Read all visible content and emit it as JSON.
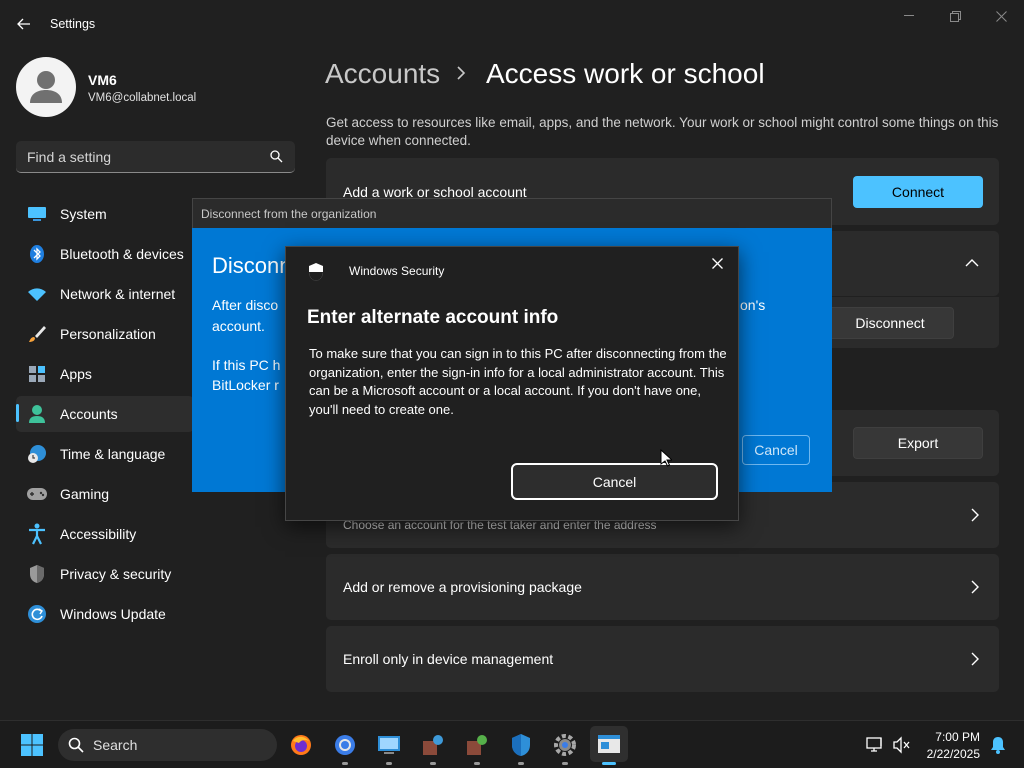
{
  "window": {
    "app_title": "Settings"
  },
  "user": {
    "name": "VM6",
    "email": "VM6@collabnet.local"
  },
  "search": {
    "placeholder": "Find a setting"
  },
  "nav": [
    {
      "label": "System",
      "icon": "monitor-icon"
    },
    {
      "label": "Bluetooth & devices",
      "icon": "bluetooth-icon"
    },
    {
      "label": "Network & internet",
      "icon": "wifi-icon"
    },
    {
      "label": "Personalization",
      "icon": "brush-icon"
    },
    {
      "label": "Apps",
      "icon": "apps-icon"
    },
    {
      "label": "Accounts",
      "icon": "person-icon",
      "active": true
    },
    {
      "label": "Time & language",
      "icon": "globe-clock-icon"
    },
    {
      "label": "Gaming",
      "icon": "gamepad-icon"
    },
    {
      "label": "Accessibility",
      "icon": "accessibility-icon"
    },
    {
      "label": "Privacy & security",
      "icon": "shield-icon"
    },
    {
      "label": "Windows Update",
      "icon": "update-icon"
    }
  ],
  "header": {
    "parent": "Accounts",
    "current": "Access work or school"
  },
  "intro": "Get access to resources like email, apps, and the network. Your work or school might control some things on this device when connected.",
  "cards": {
    "add_account": {
      "label": "Add a work or school account",
      "button": "Connect"
    },
    "disconnect_button": "Disconnect",
    "export_button": "Export",
    "test_sub": "Choose an account for the test taker and enter the address",
    "provisioning": "Add or remove a provisioning package",
    "enroll": "Enroll only in device management"
  },
  "disconnect_dialog": {
    "title": "Disconnect from the organization",
    "heading": "Disconn",
    "line1": "After disco",
    "line1_tail": "on's",
    "line2": "account.",
    "line3": "If this PC h",
    "line4": "BitLocker r",
    "cancel": "Cancel"
  },
  "security_dialog": {
    "title": "Windows Security",
    "heading": "Enter alternate account info",
    "body": "To make sure that you can sign in to this PC after disconnecting from the organization, enter the sign-in info for a local administrator account. This can be a Microsoft account or a local account. If you don't have one, you'll need to create one.",
    "cancel": "Cancel"
  },
  "taskbar": {
    "search_label": "Search",
    "time": "7:00 PM",
    "date": "2/22/2025"
  },
  "colors": {
    "accent": "#4cc2ff",
    "dialog_blue": "#0078d4",
    "background": "#202020"
  }
}
